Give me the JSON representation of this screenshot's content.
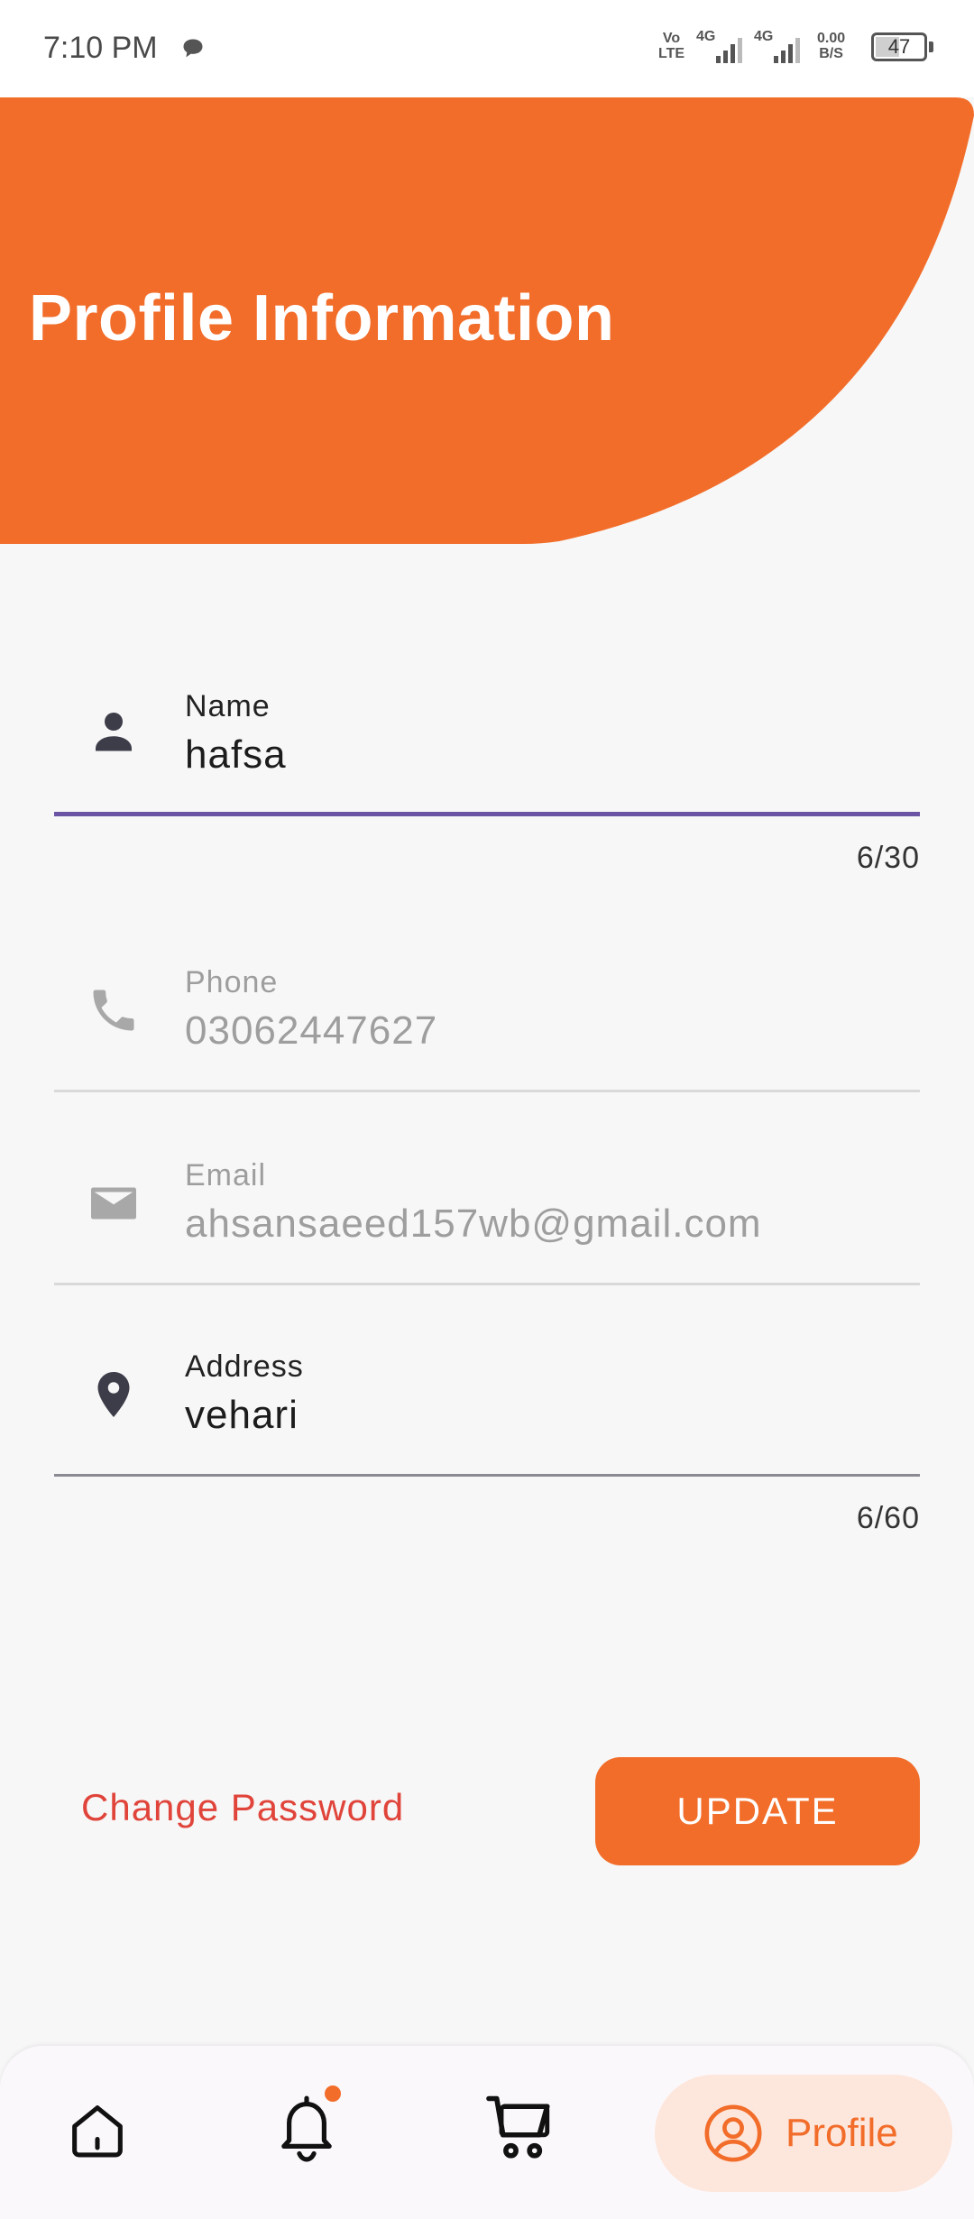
{
  "status_bar": {
    "time": "7:10 PM",
    "volte_top": "Vo",
    "volte_bottom": "LTE",
    "net1": "4G",
    "net2": "4G",
    "speed_value": "0.00",
    "speed_unit": "B/S",
    "battery": "47"
  },
  "header": {
    "title": "Profile Information",
    "color": "#f26d2a"
  },
  "form": {
    "name": {
      "label": "Name",
      "value": "hafsa",
      "counter": "6/30"
    },
    "phone": {
      "label": "Phone",
      "value": "03062447627"
    },
    "email": {
      "label": "Email",
      "value": "ahsansaeed157wb@gmail.com"
    },
    "address": {
      "label": "Address",
      "value": "vehari",
      "counter": "6/60"
    }
  },
  "actions": {
    "change_password": "Change Password",
    "update": "UPDATE"
  },
  "bottom_nav": {
    "items": [
      {
        "icon": "home-icon"
      },
      {
        "icon": "bell-icon"
      },
      {
        "icon": "cart-icon"
      },
      {
        "icon": "profile-icon",
        "label": "Profile",
        "active": true
      }
    ],
    "accent": "#f26d2a"
  }
}
